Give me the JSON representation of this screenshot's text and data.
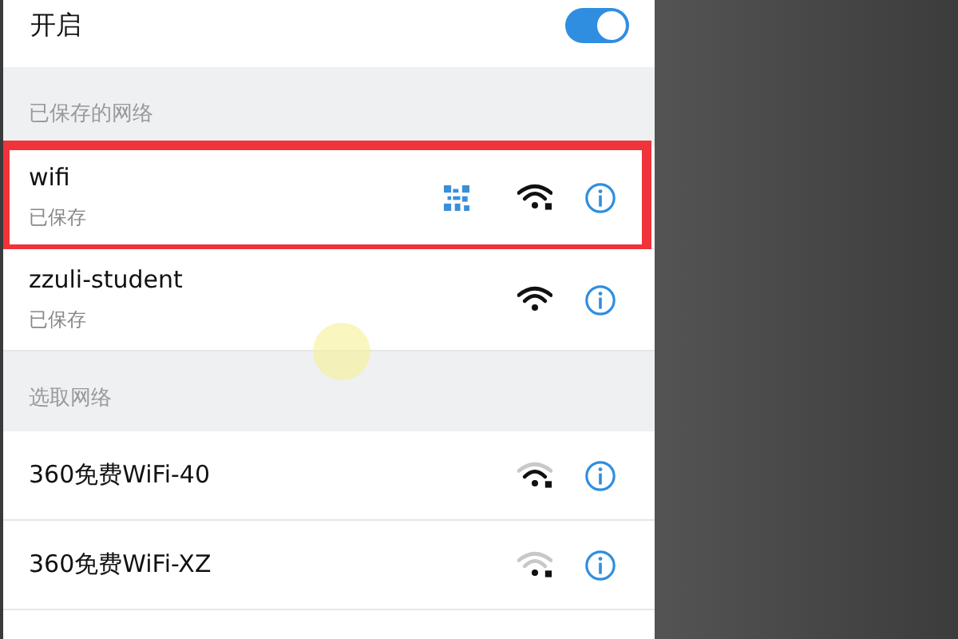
{
  "wlan_toggle": {
    "label": "开启",
    "on": true
  },
  "sections": [
    {
      "title": "已保存的网络",
      "networks": [
        {
          "name": "wifi",
          "status": "已保存",
          "kind": "strong",
          "locked": true,
          "share_qr": true,
          "highlighted": true
        },
        {
          "name": "zzuli-student",
          "status": "已保存",
          "kind": "strong",
          "locked": false,
          "share_qr": false,
          "highlighted": false
        }
      ]
    },
    {
      "title": "选取网络",
      "networks": [
        {
          "name": "360免费WiFi-40",
          "kind": "fair",
          "locked": true,
          "share_qr": false,
          "highlighted": false
        },
        {
          "name": "360免费WiFi-XZ",
          "kind": "weak",
          "locked": true,
          "share_qr": false,
          "highlighted": false
        }
      ]
    }
  ]
}
